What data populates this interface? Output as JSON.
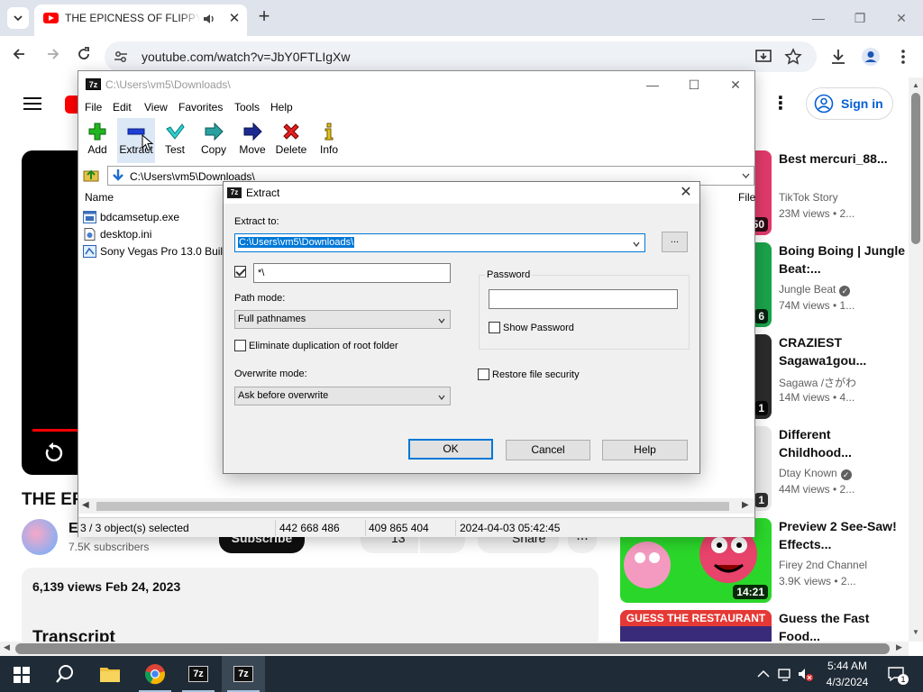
{
  "browser": {
    "tab_title": "THE EPICNESS OF FLIPPY VS",
    "url": "youtube.com/watch?v=JbY0FTLIgXw"
  },
  "youtube": {
    "video_title": "THE EP",
    "channel_initial": "E",
    "subscribers": "7.5K subscribers",
    "subscribe_label": "Subscribe",
    "like_count": "13",
    "share_label": "Share",
    "more_label": "...",
    "views_date": "6,139 views  Feb 24, 2023",
    "transcript_heading": "Transcript",
    "sign_in_label": "Sign in",
    "recommendations": [
      {
        "title": "Best mercuri_88...",
        "channel": "TikTok Story",
        "verified": false,
        "views": "23M views  •  2...",
        "duration": "50",
        "thumb_color": "#e03a6a"
      },
      {
        "title": "Boing Boing | Jungle Beat:...",
        "channel": "Jungle Beat",
        "verified": true,
        "views": "74M views  •  1...",
        "duration": "6",
        "thumb_color": "#1aa34a"
      },
      {
        "title": "CRAZIEST Sagawa1gou...",
        "channel": "Sagawa /さがわ",
        "verified": false,
        "views": "14M views  •  4...",
        "duration": "1",
        "thumb_color": "#2b2b2b"
      },
      {
        "title": "Different Childhood...",
        "channel": "Dtay Known",
        "verified": true,
        "views": "44M views  •  2...",
        "duration": "1",
        "thumb_color": "#f5f5f5"
      },
      {
        "title": "Preview 2 See-Saw! Effects...",
        "channel": "Firey 2nd Channel",
        "verified": false,
        "views": "3.9K views  •  2...",
        "duration": "14:21",
        "thumb_color": "#2bd62b"
      },
      {
        "title": "Guess the Fast Food...",
        "banner": "GUESS THE RESTAURANT",
        "thumb_color": "#3a2a7a"
      }
    ]
  },
  "sevenzip": {
    "title": "C:\\Users\\vm5\\Downloads\\",
    "menu": [
      "File",
      "Edit",
      "View",
      "Favorites",
      "Tools",
      "Help"
    ],
    "tools": [
      "Add",
      "Extract",
      "Test",
      "Copy",
      "Move",
      "Delete",
      "Info"
    ],
    "address": "C:\\Users\\vm5\\Downloads\\",
    "col_name": "Name",
    "col_file": "File",
    "files": [
      "bdcamsetup.exe",
      "desktop.ini",
      "Sony Vegas Pro 13.0 Buil..."
    ],
    "status": {
      "selected": "3 / 3 object(s) selected",
      "size": "442 668 486",
      "packed": "409 865 404",
      "modified": "2024-04-03 05:42:45"
    }
  },
  "extract_dialog": {
    "title": "Extract",
    "extract_to_label": "Extract to:",
    "extract_to_value": "C:\\Users\\vm5\\Downloads\\",
    "browse_label": "...",
    "subfolder_value": "*\\",
    "path_mode_label": "Path mode:",
    "path_mode_value": "Full pathnames",
    "eliminate_label": "Eliminate duplication of root folder",
    "overwrite_label": "Overwrite mode:",
    "overwrite_value": "Ask before overwrite",
    "password_label": "Password",
    "show_password_label": "Show Password",
    "restore_security_label": "Restore file security",
    "ok_label": "OK",
    "cancel_label": "Cancel",
    "help_label": "Help"
  },
  "taskbar": {
    "time": "5:44 AM",
    "date": "4/3/2024",
    "notif_count": "1",
    "sevenzip_label": "7z"
  },
  "colors": {
    "youtube_red": "#ff0000",
    "link_blue": "#065fd4",
    "selection_blue": "#0078d7",
    "taskbar": "#1f2b36"
  }
}
